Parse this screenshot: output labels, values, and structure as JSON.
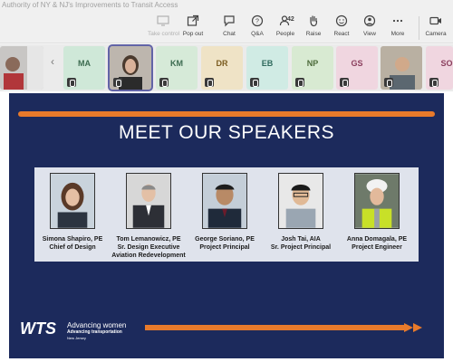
{
  "meeting": {
    "title": "Authority of NY & NJ's Improvements to Transit Access"
  },
  "toolbar": {
    "take_control": "Take control",
    "pop_out": "Pop out",
    "chat": "Chat",
    "qa": "Q&A",
    "people": "People",
    "people_count": "42",
    "raise": "Raise",
    "react": "React",
    "view": "View",
    "more": "More",
    "camera": "Camera"
  },
  "participants": [
    {
      "initials": "MA",
      "color": "#cfe8d8",
      "text_color": "#3c6b50"
    },
    {
      "initials": "KM",
      "color": "#d6ead8",
      "text_color": "#3c6b50"
    },
    {
      "initials": "DR",
      "color": "#efe3c6",
      "text_color": "#7a5b1f"
    },
    {
      "initials": "EB",
      "color": "#d0ebe4",
      "text_color": "#2f6a5d"
    },
    {
      "initials": "NP",
      "color": "#d8ead2",
      "text_color": "#4c6a3a"
    },
    {
      "initials": "GS",
      "color": "#f0d6e0",
      "text_color": "#8a3e5d"
    },
    {
      "initials": "SO",
      "color": "#f0d6e0",
      "text_color": "#8a3e5d"
    }
  ],
  "slide": {
    "heading": "MEET OUR SPEAKERS",
    "speakers": [
      {
        "name": "Simona Shapiro, PE",
        "role": "Chief of Design"
      },
      {
        "name": "Tom Lemanowicz, PE",
        "role": "Sr. Design Executive",
        "role2": "Aviation Redevelopment"
      },
      {
        "name": "George Soriano, PE",
        "role": "Project Principal"
      },
      {
        "name": "Josh Tai, AIA",
        "role": "Sr. Project Principal"
      },
      {
        "name": "Anna Domagala, PE",
        "role": "Project Engineer"
      }
    ],
    "logo": {
      "mark": "WTS",
      "line1": "Advancing women",
      "line2": "Advancing transportation",
      "line3": "New Jersey"
    },
    "colors": {
      "background": "#1c2a5c",
      "accent": "#e87a2b",
      "panel": "#dfe3ec"
    }
  }
}
